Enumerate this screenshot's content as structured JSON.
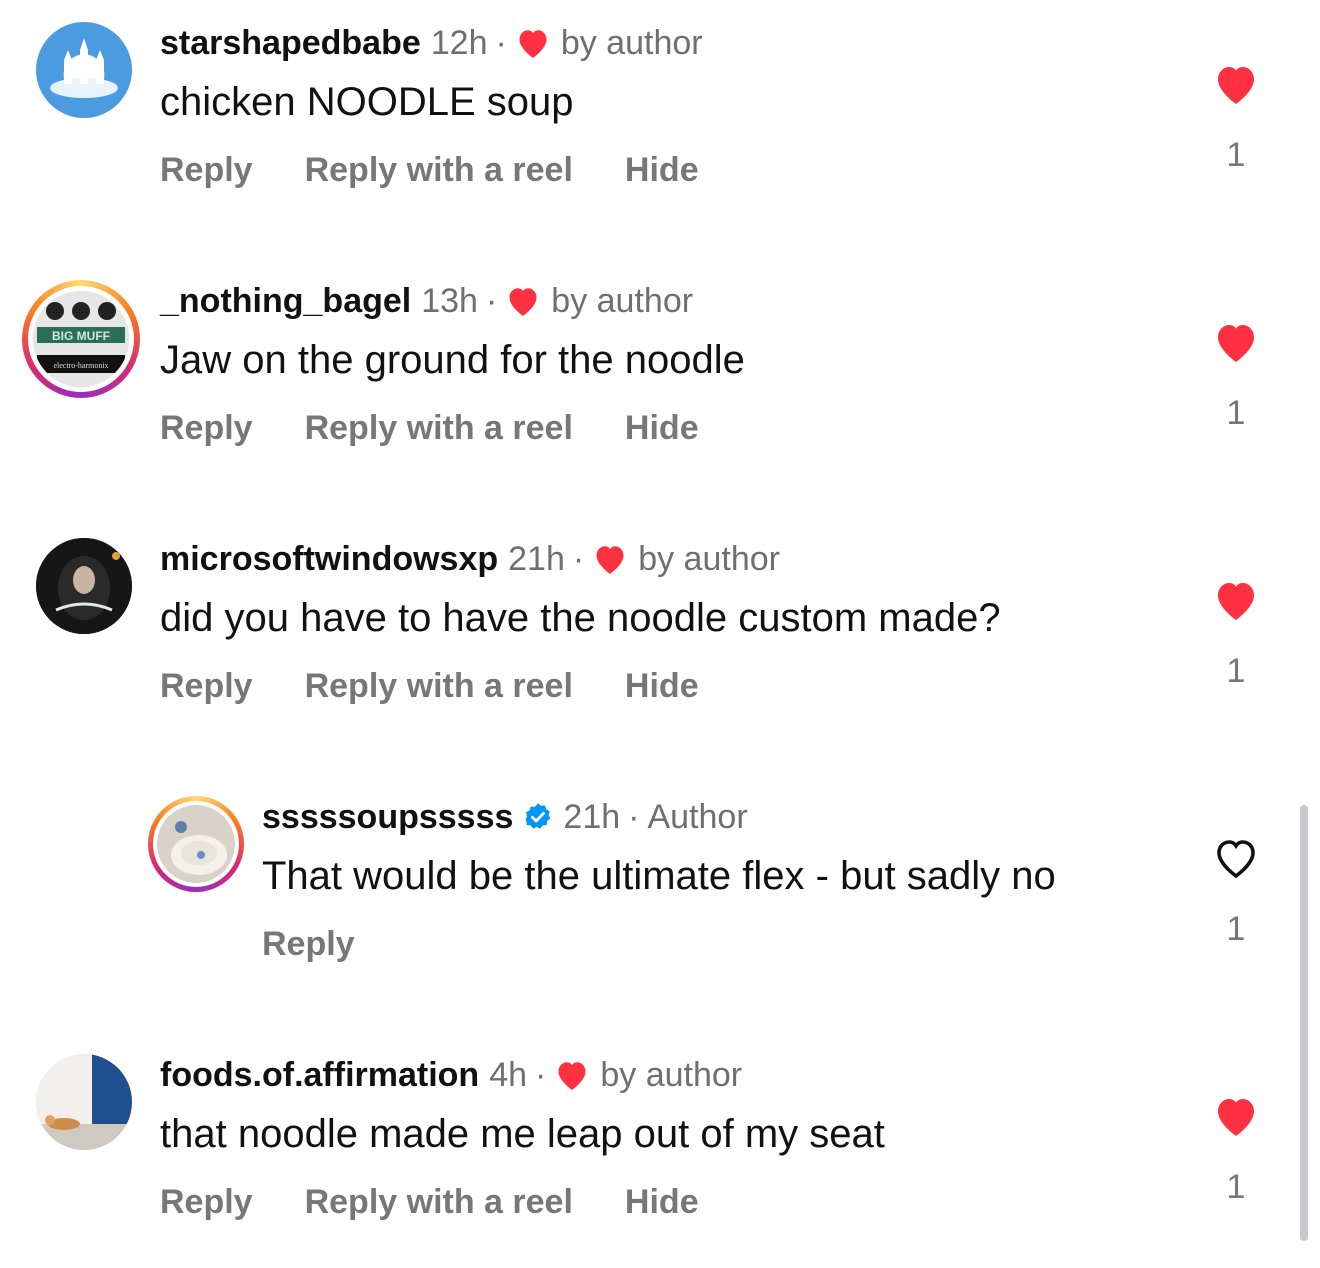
{
  "comments": [
    {
      "username": "starshapedbabe",
      "time": "12h",
      "separator": "·",
      "author_like_label": "by author",
      "text": "chicken NOODLE soup",
      "actions": [
        "Reply",
        "Reply with a reel",
        "Hide"
      ],
      "liked": true,
      "like_count": "1"
    },
    {
      "username": "_nothing_bagel",
      "time": "13h",
      "separator": "·",
      "author_like_label": "by author",
      "text": "Jaw on the ground for the noodle",
      "actions": [
        "Reply",
        "Reply with a reel",
        "Hide"
      ],
      "liked": true,
      "like_count": "1"
    },
    {
      "username": "microsoftwindowsxp",
      "time": "21h",
      "separator": "·",
      "author_like_label": "by author",
      "text": "did you have to have the noodle custom made?",
      "actions": [
        "Reply",
        "Reply with a reel",
        "Hide"
      ],
      "liked": true,
      "like_count": "1"
    },
    {
      "username": "sssssoupsssss",
      "time": "21h",
      "separator": "·",
      "author_badge": "Author",
      "verified": true,
      "text": "That would be the ultimate flex - but sadly no",
      "actions": [
        "Reply"
      ],
      "liked": false,
      "like_count": "1"
    },
    {
      "username": "foods.of.affirmation",
      "time": "4h",
      "separator": "·",
      "author_like_label": "by author",
      "text": "that noodle made me leap out of my seat",
      "actions": [
        "Reply",
        "Reply with a reel",
        "Hide"
      ],
      "liked": true,
      "like_count": "1"
    }
  ],
  "colors": {
    "like_red": "#ff3040",
    "verified_blue": "#0095f6",
    "secondary_text": "#6f6f6f"
  },
  "avatar_ring_text": "BIG MUFF",
  "avatar_ring_subtext": "electro-harmonix"
}
